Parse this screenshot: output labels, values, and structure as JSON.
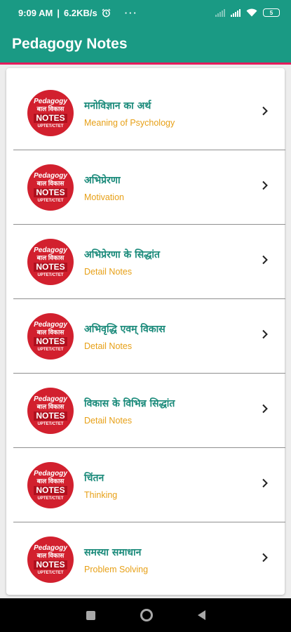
{
  "status_bar": {
    "time": "9:09 AM",
    "net_speed": "6.2KB/s",
    "alarm_icon": "alarm-icon",
    "more_indicator": "···",
    "battery_level": "5"
  },
  "app_bar": {
    "title": "Pedagogy Notes"
  },
  "logo": {
    "line1": "Pedagogy",
    "line2": "बाल विकास",
    "line3": "NOTES",
    "line4": "UPTET/CTET"
  },
  "items": [
    {
      "title": "मनोविज्ञान का अर्थ",
      "subtitle": "Meaning of Psychology"
    },
    {
      "title": "अभिप्रेरणा",
      "subtitle": "Motivation"
    },
    {
      "title": "अभिप्रेरणा के सिद्धांत",
      "subtitle": "Detail Notes"
    },
    {
      "title": "अभिवृद्धि एवम् विकास",
      "subtitle": "Detail Notes"
    },
    {
      "title": "विकास के विभिन्न सिद्धांत",
      "subtitle": "Detail Notes"
    },
    {
      "title": "चिंतन",
      "subtitle": "Thinking"
    },
    {
      "title": "समस्या समाधान",
      "subtitle": "Problem Solving"
    }
  ],
  "colors": {
    "primary": "#1a9a84",
    "accent_line": "#e51c5c",
    "title_text": "#1a8a7a",
    "subtitle_text": "#e7a017",
    "logo_red": "#d2202e"
  },
  "nav_bar": {
    "recent_icon": "square-icon",
    "home_icon": "circle-icon",
    "back_icon": "triangle-back-icon"
  }
}
